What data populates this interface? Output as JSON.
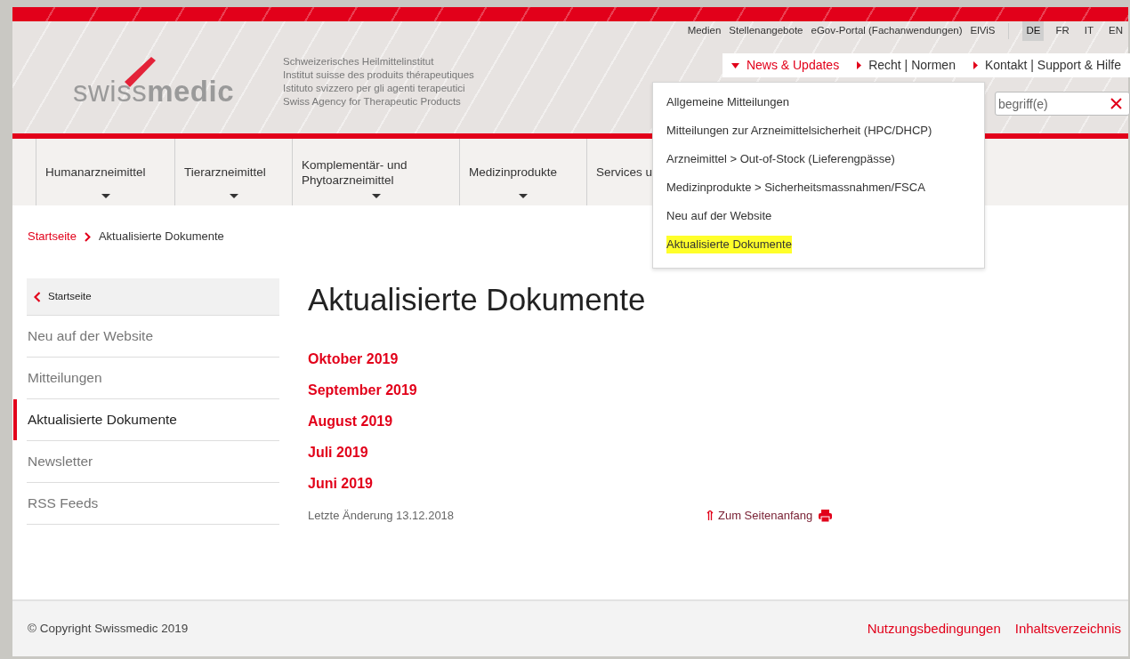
{
  "header": {
    "logo": "swiss**medic**",
    "tagline": [
      "Schweizerisches Heilmittelinstitut",
      "Institut suisse des produits thérapeutiques",
      "Istituto svizzero per gli agenti terapeutici",
      "Swiss Agency for Therapeutic Products"
    ],
    "utility_links": [
      "Medien",
      "Stellenangebote",
      "eGov-Portal (Fachanwendungen)",
      "ElViS"
    ],
    "languages": [
      {
        "label": "DE",
        "selected": true
      },
      {
        "label": "FR",
        "selected": false
      },
      {
        "label": "IT",
        "selected": false
      },
      {
        "label": "EN",
        "selected": false
      }
    ],
    "tabs": [
      {
        "label": "News & Updates",
        "selected": true
      },
      {
        "label": "Recht | Normen",
        "selected": false
      },
      {
        "label": "Kontakt | Support & Hilfe",
        "selected": false
      }
    ],
    "search": {
      "placeholder": "begriff(e)"
    }
  },
  "main_nav": [
    {
      "label": "Humanarzneimittel",
      "caret": true
    },
    {
      "label": "Tierarzneimittel",
      "caret": true
    },
    {
      "label": "Komplementär- und Phytoarzneimittel",
      "caret": true
    },
    {
      "label": "Medizinprodukte",
      "caret": true
    },
    {
      "label": "Services u",
      "caret": false
    }
  ],
  "dropdown": {
    "items": [
      {
        "label": "Allgemeine Mitteilungen",
        "selected": false
      },
      {
        "label": "Mitteilungen zur Arzneimittelsicherheit (HPC/DHCP)",
        "selected": false
      },
      {
        "label": "Arzneimittel > Out-of-Stock (Lieferengpässe)",
        "selected": false
      },
      {
        "label": "Medizinprodukte > Sicherheitsmassnahmen/FSCA",
        "selected": false
      },
      {
        "label": "Neu auf der Website",
        "selected": false
      },
      {
        "label": "Aktualisierte Dokumente",
        "selected": true
      }
    ]
  },
  "breadcrumb": [
    "Startseite",
    "Aktualisierte Dokumente"
  ],
  "sidebar": {
    "back": "Startseite",
    "items": [
      {
        "label": "Neu auf der Website",
        "selected": false
      },
      {
        "label": "Mitteilungen",
        "selected": false
      },
      {
        "label": "Aktualisierte Dokumente",
        "selected": true
      },
      {
        "label": "Newsletter",
        "selected": false
      },
      {
        "label": "RSS Feeds",
        "selected": false
      }
    ]
  },
  "content": {
    "title": "Aktualisierte Dokumente",
    "links": [
      "Oktober 2019",
      "September 2019",
      "August 2019",
      "Juli 2019",
      "Juni 2019"
    ],
    "last_changed": "Letzte Änderung 13.12.2018",
    "top_link": "Zum Seitenanfang"
  },
  "footer": {
    "copyright": "© Copyright Swissmedic 2019",
    "links": [
      "Nutzungsbedingungen",
      "Inhaltsverzeichnis"
    ]
  }
}
